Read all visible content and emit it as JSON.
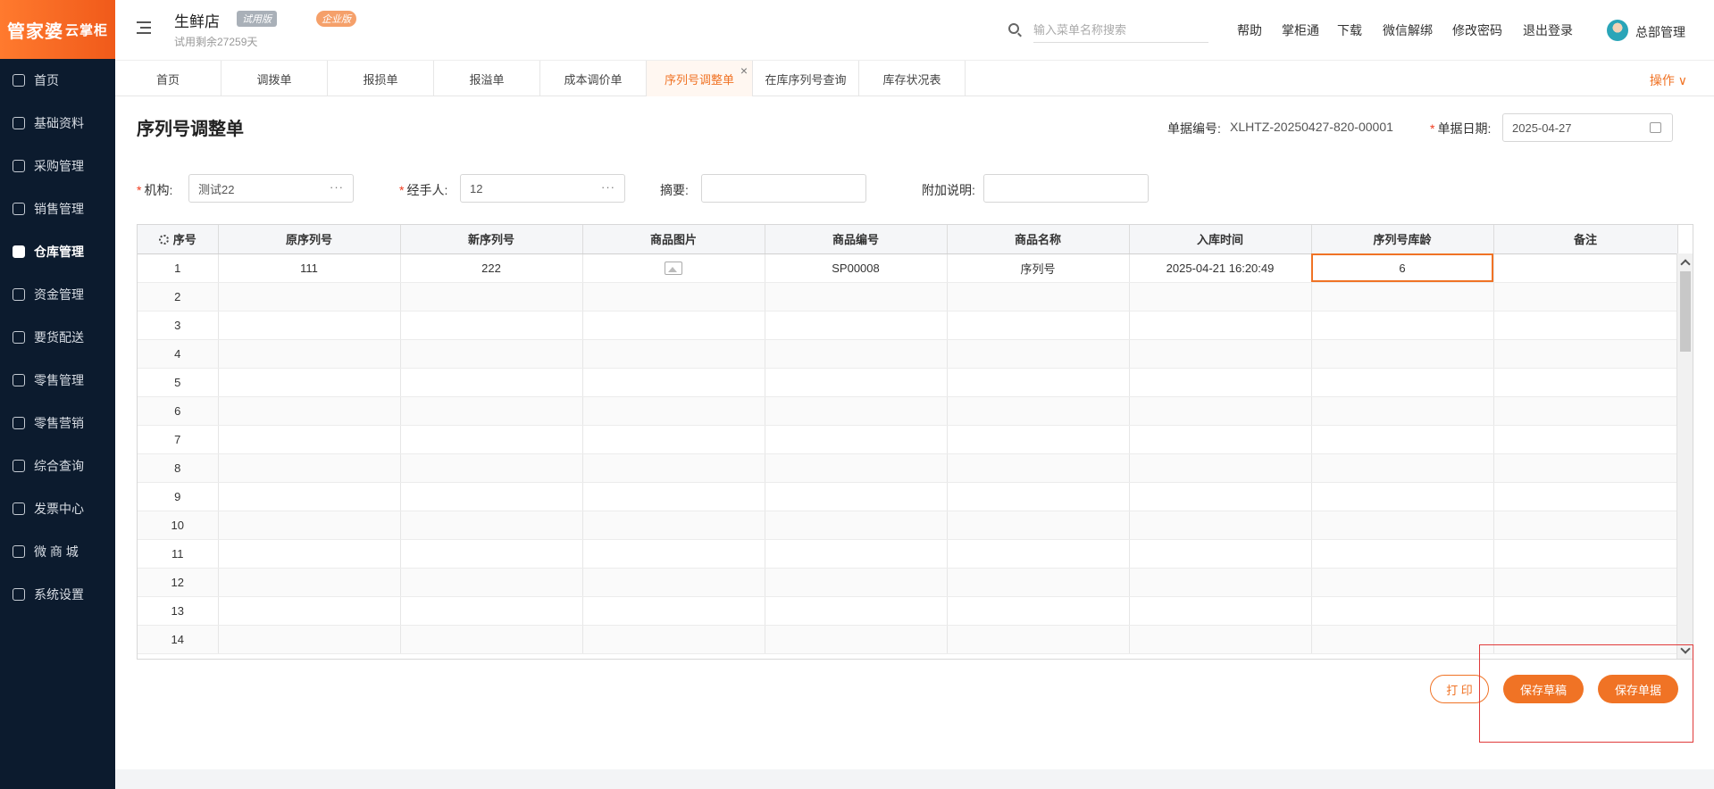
{
  "brand": {
    "logo_main": "管家婆",
    "logo_sub": "云掌柜"
  },
  "sidebar": {
    "items": [
      {
        "label": "首页",
        "icon": "globe-icon"
      },
      {
        "label": "基础资料",
        "icon": "home-icon"
      },
      {
        "label": "采购管理",
        "icon": "cart-icon"
      },
      {
        "label": "销售管理",
        "icon": "sales-icon"
      },
      {
        "label": "仓库管理",
        "icon": "warehouse-icon"
      },
      {
        "label": "资金管理",
        "icon": "money-icon"
      },
      {
        "label": "要货配送",
        "icon": "delivery-icon"
      },
      {
        "label": "零售管理",
        "icon": "retail-icon"
      },
      {
        "label": "零售营销",
        "icon": "gift-icon"
      },
      {
        "label": "综合查询",
        "icon": "chart-icon"
      },
      {
        "label": "发票中心",
        "icon": "invoice-icon"
      },
      {
        "label": "微 商 城",
        "icon": "shop-icon"
      },
      {
        "label": "系统设置",
        "icon": "gear-icon"
      }
    ],
    "active": "仓库管理"
  },
  "header": {
    "store_name": "生鲜店",
    "badge_trial": "试用版",
    "badge_enterprise": "企业版",
    "trial_note": "试用剩余27259天",
    "search_placeholder": "输入菜单名称搜索",
    "links": [
      "帮助",
      "掌柜通",
      "下载",
      "微信解绑",
      "修改密码",
      "退出登录"
    ],
    "user": "总部管理"
  },
  "tabs": {
    "items": [
      "首页",
      "调拨单",
      "报损单",
      "报溢单",
      "成本调价单",
      "序列号调整单",
      "在库序列号查询",
      "库存状况表"
    ],
    "active": "序列号调整单",
    "ops_label": "操作 ∨"
  },
  "form": {
    "title": "序列号调整单",
    "doc_no_label": "单据编号:",
    "doc_no": "XLHTZ-20250427-820-00001",
    "doc_date_label": "单据日期:",
    "doc_date": "2025-04-27",
    "org_label": "机构:",
    "org": "测试22",
    "handler_label": "经手人:",
    "handler": "12",
    "summary_label": "摘要:",
    "summary": "",
    "note_label": "附加说明:",
    "note": ""
  },
  "table": {
    "columns": [
      "序号",
      "原序列号",
      "新序列号",
      "商品图片",
      "商品编号",
      "商品名称",
      "入库时间",
      "序列号库龄",
      "备注"
    ],
    "rows": [
      {
        "no": "1",
        "old_sn": "111",
        "new_sn": "222",
        "image": "image-icon",
        "code": "SP00008",
        "name": "序列号",
        "in_time": "2025-04-21 16:20:49",
        "age": "6",
        "remark": ""
      },
      {
        "no": "2"
      },
      {
        "no": "3"
      },
      {
        "no": "4"
      },
      {
        "no": "5"
      },
      {
        "no": "6"
      },
      {
        "no": "7"
      },
      {
        "no": "8"
      },
      {
        "no": "9"
      },
      {
        "no": "10"
      },
      {
        "no": "11"
      },
      {
        "no": "12"
      },
      {
        "no": "13"
      },
      {
        "no": "14"
      }
    ]
  },
  "actions": {
    "print": "打 印",
    "save_draft": "保存草稿",
    "save_doc": "保存单据"
  },
  "colors": {
    "accent": "#f07325",
    "sidebar_bg": "#0c1b2e"
  }
}
